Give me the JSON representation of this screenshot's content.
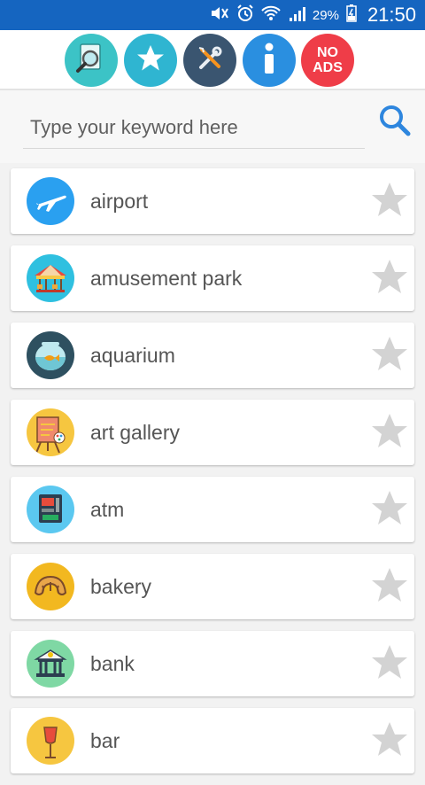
{
  "status_bar": {
    "battery_percent": "29%",
    "time": "21:50",
    "icons": [
      "mute-icon",
      "alarm-icon",
      "wifi-icon",
      "signal-icon",
      "battery-icon"
    ]
  },
  "toolbar": {
    "buttons": [
      {
        "name": "search-places-button",
        "icon": "map-search-icon",
        "color": "#3cc3c6"
      },
      {
        "name": "favorites-button",
        "icon": "star-icon",
        "color": "#2fb5d1"
      },
      {
        "name": "settings-button",
        "icon": "tools-icon",
        "color": "#3a5570"
      },
      {
        "name": "info-button",
        "icon": "info-icon",
        "color": "#2a8fe0"
      },
      {
        "name": "no-ads-button",
        "icon": "no-ads-icon",
        "color": "#ef3d48",
        "label_line1": "NO",
        "label_line2": "ADS"
      }
    ]
  },
  "search": {
    "placeholder": "Type your keyword here",
    "value": ""
  },
  "categories": [
    {
      "label": "airport",
      "icon": "airplane-icon",
      "color": "#2aa0f0"
    },
    {
      "label": "amusement park",
      "icon": "carousel-icon",
      "color": "#2fc0e0"
    },
    {
      "label": "aquarium",
      "icon": "fishbowl-icon",
      "color": "#2e5060"
    },
    {
      "label": "art gallery",
      "icon": "easel-icon",
      "color": "#f6c640"
    },
    {
      "label": "atm",
      "icon": "atm-icon",
      "color": "#5bc8f0"
    },
    {
      "label": "bakery",
      "icon": "croissant-icon",
      "color": "#f2b820"
    },
    {
      "label": "bank",
      "icon": "bank-building-icon",
      "color": "#7fd8a4"
    },
    {
      "label": "bar",
      "icon": "cocktail-icon",
      "color": "#f6c640"
    }
  ],
  "colors": {
    "status_bar": "#1565c0",
    "star_inactive": "#d3d3d3",
    "search_icon": "#2e86de"
  }
}
